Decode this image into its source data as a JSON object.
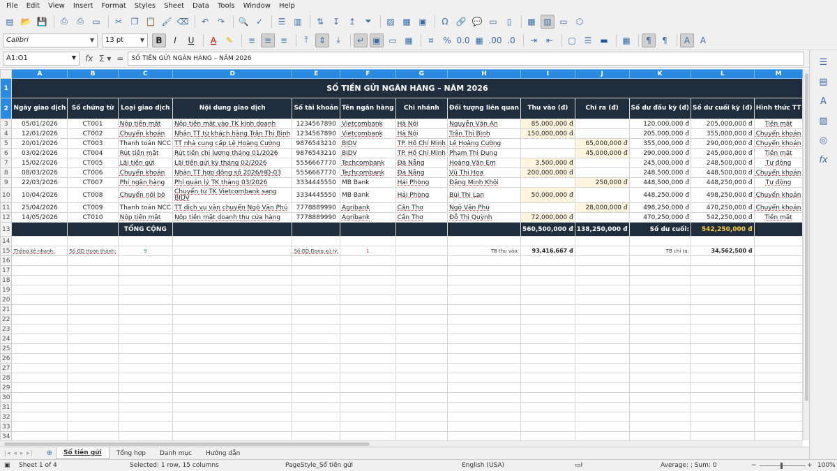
{
  "menu": [
    "File",
    "Edit",
    "View",
    "Insert",
    "Format",
    "Styles",
    "Sheet",
    "Data",
    "Tools",
    "Window",
    "Help"
  ],
  "format": {
    "font_name": "Calibri",
    "font_size": "13 pt"
  },
  "formula": {
    "name_box": "A1:O1",
    "content": "SỐ TIỀN GỬI NGÂN HÀNG – NĂM 2026"
  },
  "columns": [
    "A",
    "B",
    "C",
    "D",
    "E",
    "F",
    "G",
    "H",
    "I",
    "J",
    "K",
    "L",
    "M"
  ],
  "title": "SỐ TIỀN GỬI NGÂN HÀNG – NĂM 2026",
  "headers": [
    "Ngày giao dịch",
    "Số chứng từ",
    "Loại giao dịch",
    "Nội dung giao dịch",
    "Số tài khoản",
    "Tên ngân hàng",
    "Chi nhánh",
    "Đối tượng liên quan",
    "Thu vào (đ)",
    "Chi ra (đ)",
    "Số dư đầu kỳ (đ)",
    "Số dư cuối kỳ (đ)",
    "Hình thức TT"
  ],
  "rows": [
    {
      "date": "05/01/2026",
      "doc": "CT001",
      "type": "Nộp tiền mặt",
      "desc": "Nộp tiền mặt vào TK kinh doanh",
      "acct": "1234567890",
      "bank": "Vietcombank",
      "branch": "Hà Nội",
      "party": "Nguyễn Văn An",
      "in": "85,000,000 đ",
      "out": "",
      "open": "120,000,000 đ",
      "close": "205,000,000 đ",
      "method": "Tiền mặt"
    },
    {
      "date": "12/01/2026",
      "doc": "CT002",
      "type": "Chuyển khoản",
      "desc": "Nhận TT từ khách hàng Trần Thị Bình",
      "acct": "1234567890",
      "bank": "Vietcombank",
      "branch": "Hà Nội",
      "party": "Trần Thị Bình",
      "in": "150,000,000 đ",
      "out": "",
      "open": "205,000,000 đ",
      "close": "355,000,000 đ",
      "method": "Chuyển khoản"
    },
    {
      "date": "20/01/2026",
      "doc": "CT003",
      "type": "Thanh toán NCC",
      "desc": "TT nhà cung cấp Lê Hoàng Cường",
      "acct": "9876543210",
      "bank": "BIDV",
      "branch": "TP. Hồ Chí Minh",
      "party": "Lê Hoàng Cường",
      "in": "",
      "out": "65,000,000 đ",
      "open": "355,000,000 đ",
      "close": "290,000,000 đ",
      "method": "Chuyển khoản"
    },
    {
      "date": "03/02/2026",
      "doc": "CT004",
      "type": "Rút tiền mặt",
      "desc": "Rút tiền chi lương tháng 01/2026",
      "acct": "9876543210",
      "bank": "BIDV",
      "branch": "TP. Hồ Chí Minh",
      "party": "Phạm Thị Dung",
      "in": "",
      "out": "45,000,000 đ",
      "open": "290,000,000 đ",
      "close": "245,000,000 đ",
      "method": "Tiền mặt"
    },
    {
      "date": "15/02/2026",
      "doc": "CT005",
      "type": "Lãi tiền gửi",
      "desc": "Lãi tiền gửi kỳ tháng 02/2026",
      "acct": "5556667770",
      "bank": "Techcombank",
      "branch": "Đà Nẵng",
      "party": "Hoàng Văn Em",
      "in": "3,500,000 đ",
      "out": "",
      "open": "245,000,000 đ",
      "close": "248,500,000 đ",
      "method": "Tự động"
    },
    {
      "date": "08/03/2026",
      "doc": "CT006",
      "type": "Chuyển khoản",
      "desc": "Nhận TT hợp đồng số 2026/HĐ-03",
      "acct": "5556667770",
      "bank": "Techcombank",
      "branch": "Đà Nẵng",
      "party": "Vũ Thị Hoa",
      "in": "200,000,000 đ",
      "out": "",
      "open": "248,500,000 đ",
      "close": "448,500,000 đ",
      "method": "Chuyển khoản"
    },
    {
      "date": "22/03/2026",
      "doc": "CT007",
      "type": "Phí ngân hàng",
      "desc": "Phí quản lý TK tháng 03/2026",
      "acct": "3334445550",
      "bank": "MB Bank",
      "branch": "Hải Phòng",
      "party": "Đặng Minh Khôi",
      "in": "",
      "out": "250,000 đ",
      "open": "448,500,000 đ",
      "close": "448,250,000 đ",
      "method": "Tự động"
    },
    {
      "date": "10/04/2026",
      "doc": "CT008",
      "type": "Chuyển nội bộ",
      "desc": "Chuyển từ TK Vietcombank sang BIDV",
      "acct": "3334445550",
      "bank": "MB Bank",
      "branch": "Hải Phòng",
      "party": "Bùi Thị Lan",
      "in": "50,000,000 đ",
      "out": "",
      "open": "448,250,000 đ",
      "close": "498,250,000 đ",
      "method": "Chuyển khoản"
    },
    {
      "date": "25/04/2026",
      "doc": "CT009",
      "type": "Thanh toán NCC",
      "desc": "TT dịch vụ vận chuyển Ngô Văn Phú",
      "acct": "7778889990",
      "bank": "Agribank",
      "branch": "Cần Thơ",
      "party": "Ngô Văn Phú",
      "in": "",
      "out": "28,000,000 đ",
      "open": "498,250,000 đ",
      "close": "470,250,000 đ",
      "method": "Chuyển khoản"
    },
    {
      "date": "14/05/2026",
      "doc": "CT010",
      "type": "Nộp tiền mặt",
      "desc": "Nộp tiền mặt doanh thu cửa hàng",
      "acct": "7778889990",
      "bank": "Agribank",
      "branch": "Cần Thơ",
      "party": "Đỗ Thị Quỳnh",
      "in": "72,000,000 đ",
      "out": "",
      "open": "470,250,000 đ",
      "close": "542,250,000 đ",
      "method": "Tiền mặt"
    }
  ],
  "totals": {
    "label": "TỔNG CỘNG",
    "in": "560,500,000 đ",
    "out": "138,250,000 đ",
    "final_label": "Số dư cuối:",
    "final": "542,250,000 đ"
  },
  "stats": {
    "label": "Thống kê nhanh:",
    "done_label": "Số GD Hoàn thành:",
    "done": "9",
    "pending_label": "Số GD Đang xử lý:",
    "pending": "1",
    "avg_in_label": "TB thu vào:",
    "avg_in": "93,416,667 đ",
    "avg_out_label": "TB chi ra:",
    "avg_out": "34,562,500 đ"
  },
  "tabs": [
    "Sổ tiền gửi",
    "Tổng hợp",
    "Danh mục",
    "Hướng dẫn"
  ],
  "status": {
    "sheet": "Sheet 1 of 4",
    "selected": "Selected: 1 row, 15 columns",
    "page_style": "PageStyle_Sổ tiền gửi",
    "language": "English (USA)",
    "summary": "Average: ; Sum: 0",
    "zoom": "100%"
  }
}
